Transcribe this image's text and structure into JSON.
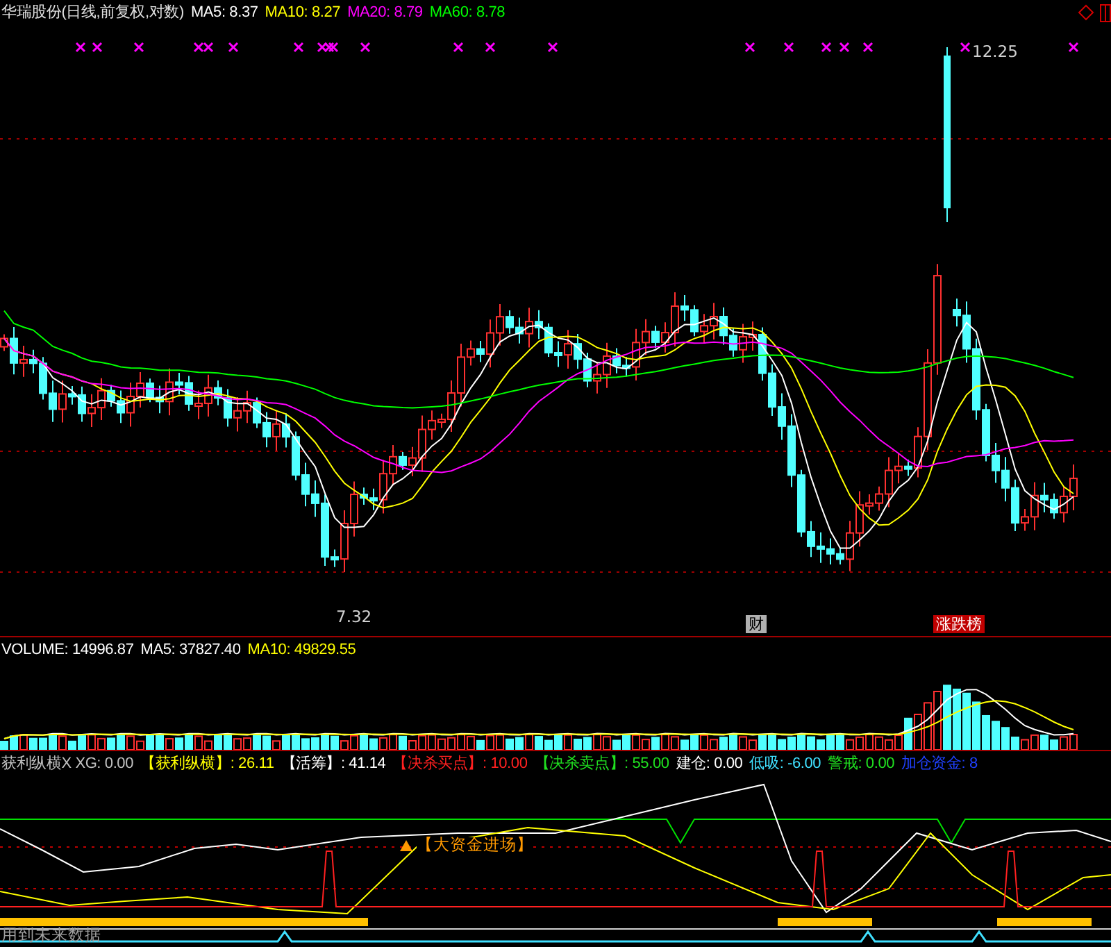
{
  "price_pane": {
    "title": "华瑞股份(日线,前复权,对数)",
    "indicators": [
      {
        "label": "MA5:",
        "value": "8.37",
        "color": "#ffffff"
      },
      {
        "label": "MA10:",
        "value": "8.27",
        "color": "#ffff00"
      },
      {
        "label": "MA20:",
        "value": "8.79",
        "color": "#ff00ff"
      },
      {
        "label": "MA60:",
        "value": "8.78",
        "color": "#00ff00"
      }
    ],
    "high_label": "12.25",
    "low_label": "7.32",
    "event_tags": [
      {
        "text": "财"
      },
      {
        "text": "涨跌榜"
      }
    ]
  },
  "volume_pane": {
    "indicators": [
      {
        "label": "VOLUME:",
        "value": "14996.87",
        "color": "#ffffff"
      },
      {
        "label": "MA5:",
        "value": "37827.40",
        "color": "#ffffff"
      },
      {
        "label": "MA10:",
        "value": "49829.55",
        "color": "#ffff00"
      }
    ]
  },
  "signal_pane": {
    "indicators": [
      {
        "label": "获利纵横X XG:",
        "value": "0.00",
        "color": "#c0c0c0"
      },
      {
        "label": "【获利纵横】:",
        "value": "26.11",
        "color": "#ffff00"
      },
      {
        "label": "【活筹】:",
        "value": "41.14",
        "color": "#ffffff"
      },
      {
        "label": "【决杀买点】:",
        "value": "10.00",
        "color": "#ff2020"
      },
      {
        "label": "【决杀卖点】:",
        "value": "55.00",
        "color": "#20e020"
      },
      {
        "label": "建仓:",
        "value": "0.00",
        "color": "#ffffff"
      },
      {
        "label": "低吸:",
        "value": "-6.00",
        "color": "#40e0ff"
      },
      {
        "label": "警戒:",
        "value": "0.00",
        "color": "#20e020"
      },
      {
        "label": "加仓资金:",
        "value": "8",
        "color": "#2040ff"
      }
    ],
    "annotation": "【大资金进场】",
    "footer_note": "用到未来数据"
  }
}
